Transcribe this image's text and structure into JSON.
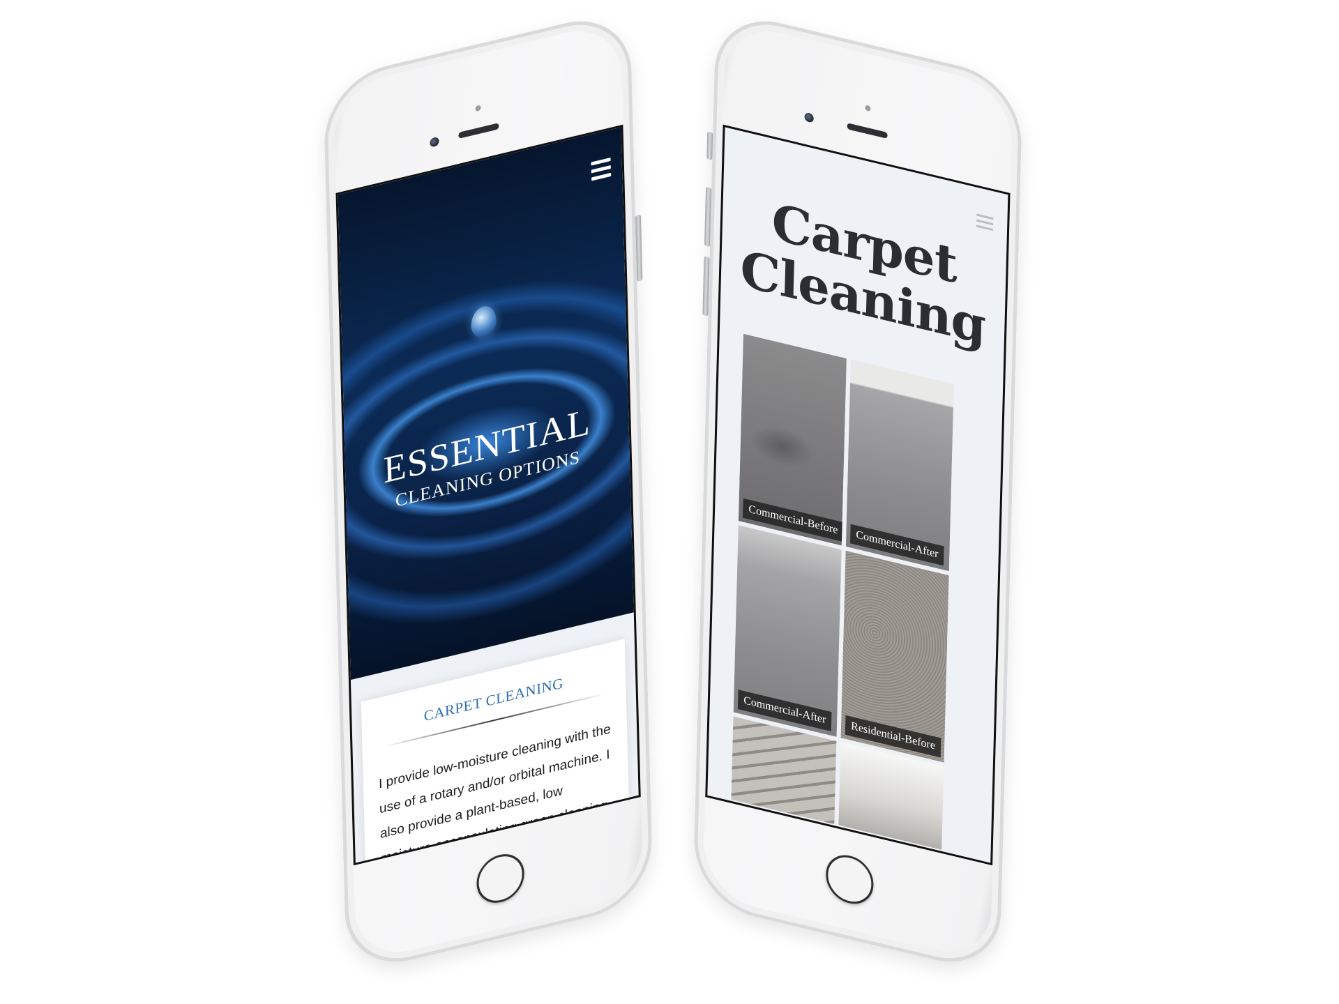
{
  "left_phone": {
    "hero": {
      "title": "ESSENTIAL",
      "subtitle": "CLEANING OPTIONS"
    },
    "card": {
      "title": "CARPET CLEANING",
      "body": "I provide low-moisture cleaning with the use of a rotary and/or orbital machine. I also provide a plant-based, low moisture encapsulating green cleaning solution for all types of carpets."
    },
    "menu_icon": "hamburger-menu-icon"
  },
  "right_phone": {
    "page_title_line1": "Carpet",
    "page_title_line2": "Cleaning",
    "menu_icon": "hamburger-menu-icon",
    "gallery": [
      {
        "caption": "Commercial-Before"
      },
      {
        "caption": "Commercial-After"
      },
      {
        "caption": "Commercial-After"
      },
      {
        "caption": "Residential-Before"
      }
    ]
  },
  "colors": {
    "accent_blue": "#2d6fb3",
    "hero_dark": "#0b2b56",
    "page_bg": "#eef1f5"
  }
}
